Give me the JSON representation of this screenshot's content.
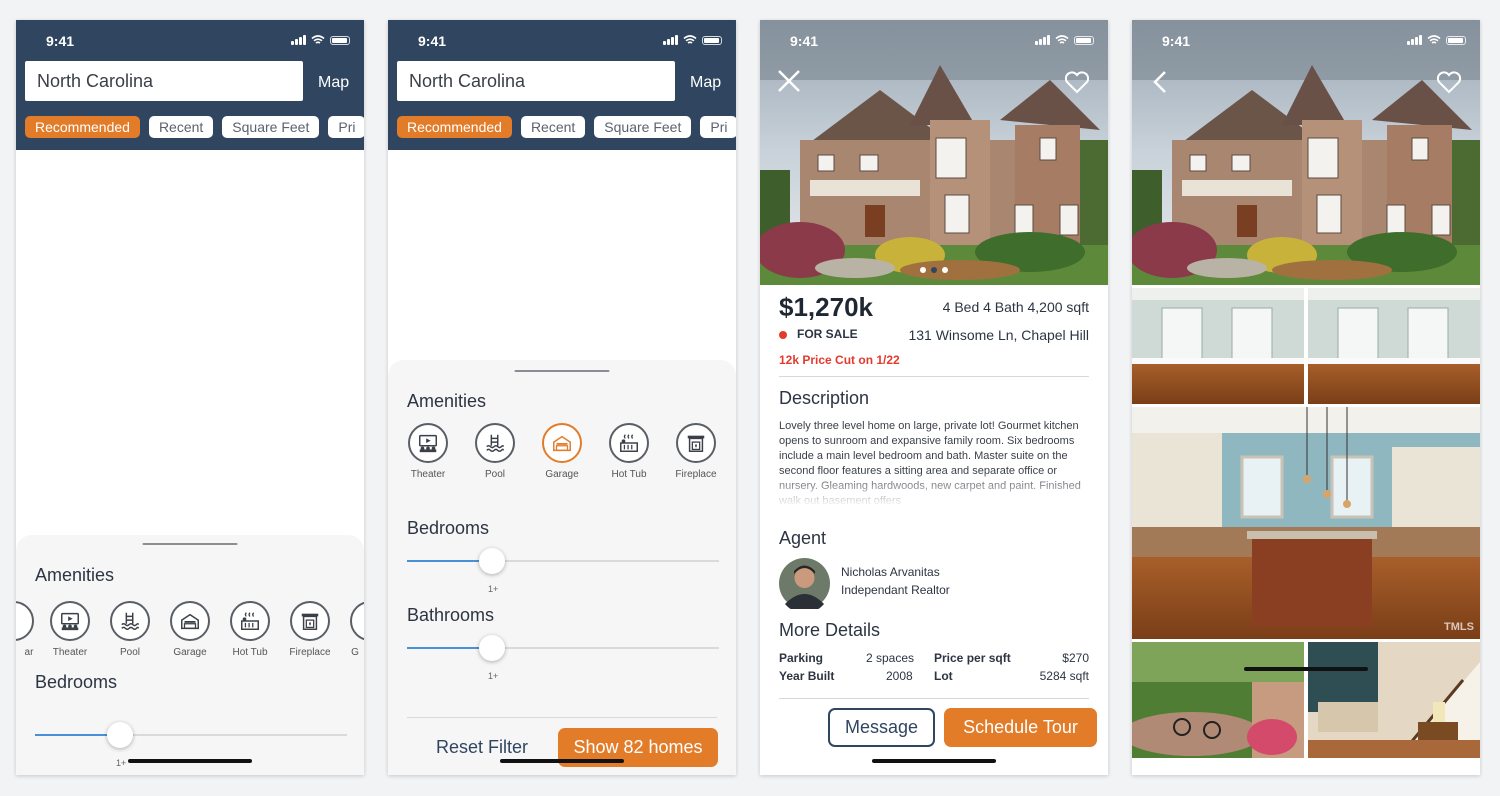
{
  "status": {
    "time": "9:41"
  },
  "search": {
    "value": "North Carolina",
    "map_label": "Map"
  },
  "filters": {
    "chips": [
      "Recommended",
      "Recent",
      "Square Feet",
      "Pri"
    ]
  },
  "filter_sheet": {
    "amenities_title": "Amenities",
    "amenities": [
      {
        "label": "Theater",
        "icon": "theater-icon"
      },
      {
        "label": "Pool",
        "icon": "pool-icon"
      },
      {
        "label": "Garage",
        "icon": "garage-icon"
      },
      {
        "label": "Hot Tub",
        "icon": "hot-tub-icon"
      },
      {
        "label": "Fireplace",
        "icon": "fireplace-icon"
      }
    ],
    "partial_left_label": "ar",
    "partial_right_label": "G",
    "bedrooms_title": "Bedrooms",
    "bathrooms_title": "Bathrooms",
    "slider_value_label": "1+",
    "reset_label": "Reset Filter",
    "show_label": "Show 82 homes"
  },
  "listing": {
    "price": "$1,270k",
    "specs": "4 Bed 4 Bath 4,200 sqft",
    "status": "FOR SALE",
    "address": "131 Winsome Ln, Chapel Hill",
    "price_cut": "12k Price Cut on 1/22",
    "description_title": "Description",
    "description": "Lovely three level home on large, private lot! Gourmet kitchen opens to sunroom and expansive family room. Six bedrooms include a main level bedroom and bath. Master suite on the second floor features a sitting area and separate office or nursery. Gleaming hardwoods, new carpet and paint. Finished walk out basement offers",
    "agent_title": "Agent",
    "agent_name": "Nicholas Arvanitas",
    "agent_role": "Independant Realtor",
    "more_title": "More Details",
    "details": {
      "parking_label": "Parking",
      "parking_value": "2 spaces",
      "year_label": "Year Built",
      "year_value": "2008",
      "ppsf_label": "Price per sqft",
      "ppsf_value": "$270",
      "lot_label": "Lot",
      "lot_value": "5284 sqft"
    },
    "message_label": "Message",
    "tour_label": "Schedule Tour",
    "watermark": "TMLS"
  },
  "colors": {
    "header": "#304660",
    "accent": "#e27c29",
    "slider": "#4a90d9",
    "alert": "#e23b2e"
  }
}
